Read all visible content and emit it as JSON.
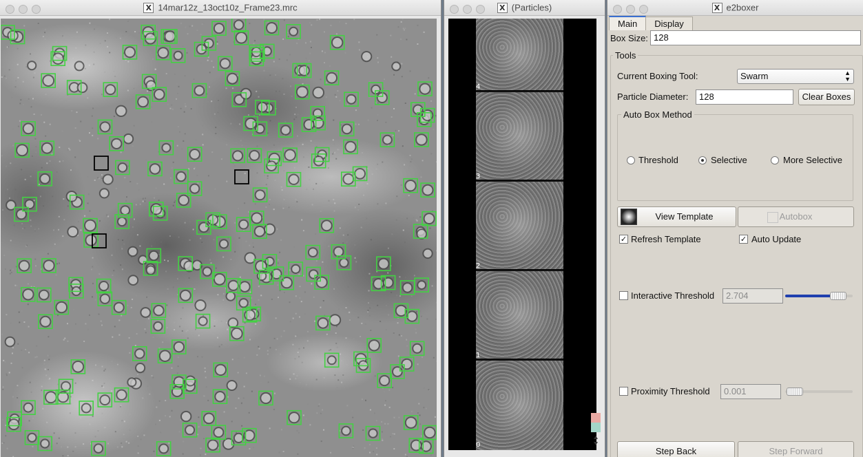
{
  "micrograph_window": {
    "title": "14mar12z_13oct10z_Frame23.mrc",
    "accepted_box_color": "#43d143",
    "reference_box_color": "#000000"
  },
  "particles_window": {
    "title": "(Particles)",
    "tile_labels": [
      "4",
      "3",
      "2",
      "1",
      "0"
    ]
  },
  "e2boxer_window": {
    "title": "e2boxer",
    "tabs": [
      "Main",
      "Display"
    ],
    "box_size_label": "Box Size:",
    "box_size_value": "128",
    "tools_label": "Tools",
    "current_tool_label": "Current Boxing Tool:",
    "current_tool_value": "Swarm",
    "particle_diameter_label": "Particle Diameter:",
    "particle_diameter_value": "128",
    "clear_boxes": "Clear Boxes",
    "auto_box_method_label": "Auto Box Method",
    "methods": [
      "Threshold",
      "Selective",
      "More Selective"
    ],
    "selected_method": "Selective",
    "view_template": "View Template",
    "autobox": "Autobox",
    "refresh_template": "Refresh Template",
    "refresh_template_checked": true,
    "auto_update": "Auto Update",
    "auto_update_checked": true,
    "interactive_threshold_label": "Interactive Threshold",
    "interactive_threshold_value": "2.704",
    "interactive_threshold_checked": false,
    "interactive_threshold_level": 0.85,
    "proximity_threshold_label": "Proximity Threshold",
    "proximity_threshold_value": "0.001",
    "proximity_threshold_checked": false,
    "proximity_threshold_level": 0.03,
    "step_back": "Step Back",
    "step_forward": "Step Forward",
    "accent_color": "#1f3fae"
  }
}
